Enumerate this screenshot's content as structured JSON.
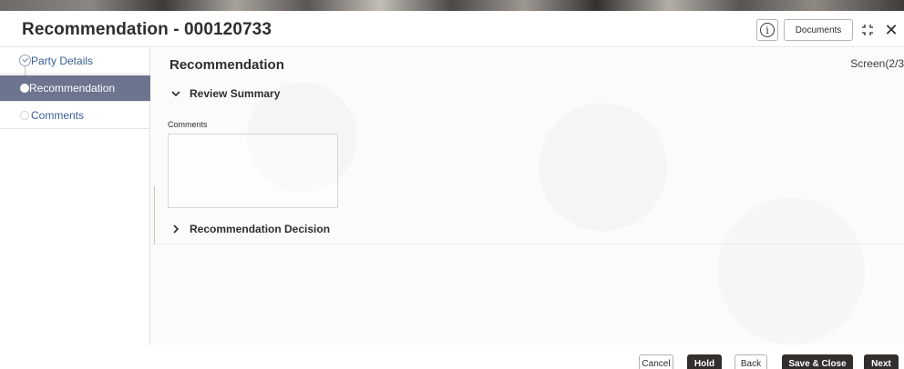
{
  "header": {
    "title": "Recommendation - 000120733",
    "info_icon": "i",
    "documents_label": "Documents",
    "close_icon": "✕"
  },
  "sidebar": {
    "items": [
      {
        "label": "Party Details",
        "state": "completed"
      },
      {
        "label": "Recommendation",
        "state": "active"
      },
      {
        "label": "Comments",
        "state": "pending"
      }
    ]
  },
  "main": {
    "title": "Recommendation",
    "screen_indicator": "Screen(2/3",
    "review_summary_label": "Review Summary",
    "comments_label": "Comments",
    "comments_value": "",
    "recommendation_decision_label": "Recommendation Decision"
  },
  "footer": {
    "cancel_label": "Cancel",
    "hold_label": "Hold",
    "back_label": "Back",
    "save_close_label": "Save & Close",
    "next_label": "Next"
  },
  "colors": {
    "active_nav_bg": "#6d7490",
    "link_text": "#3a5f93",
    "primary_button": "#322e2c"
  }
}
